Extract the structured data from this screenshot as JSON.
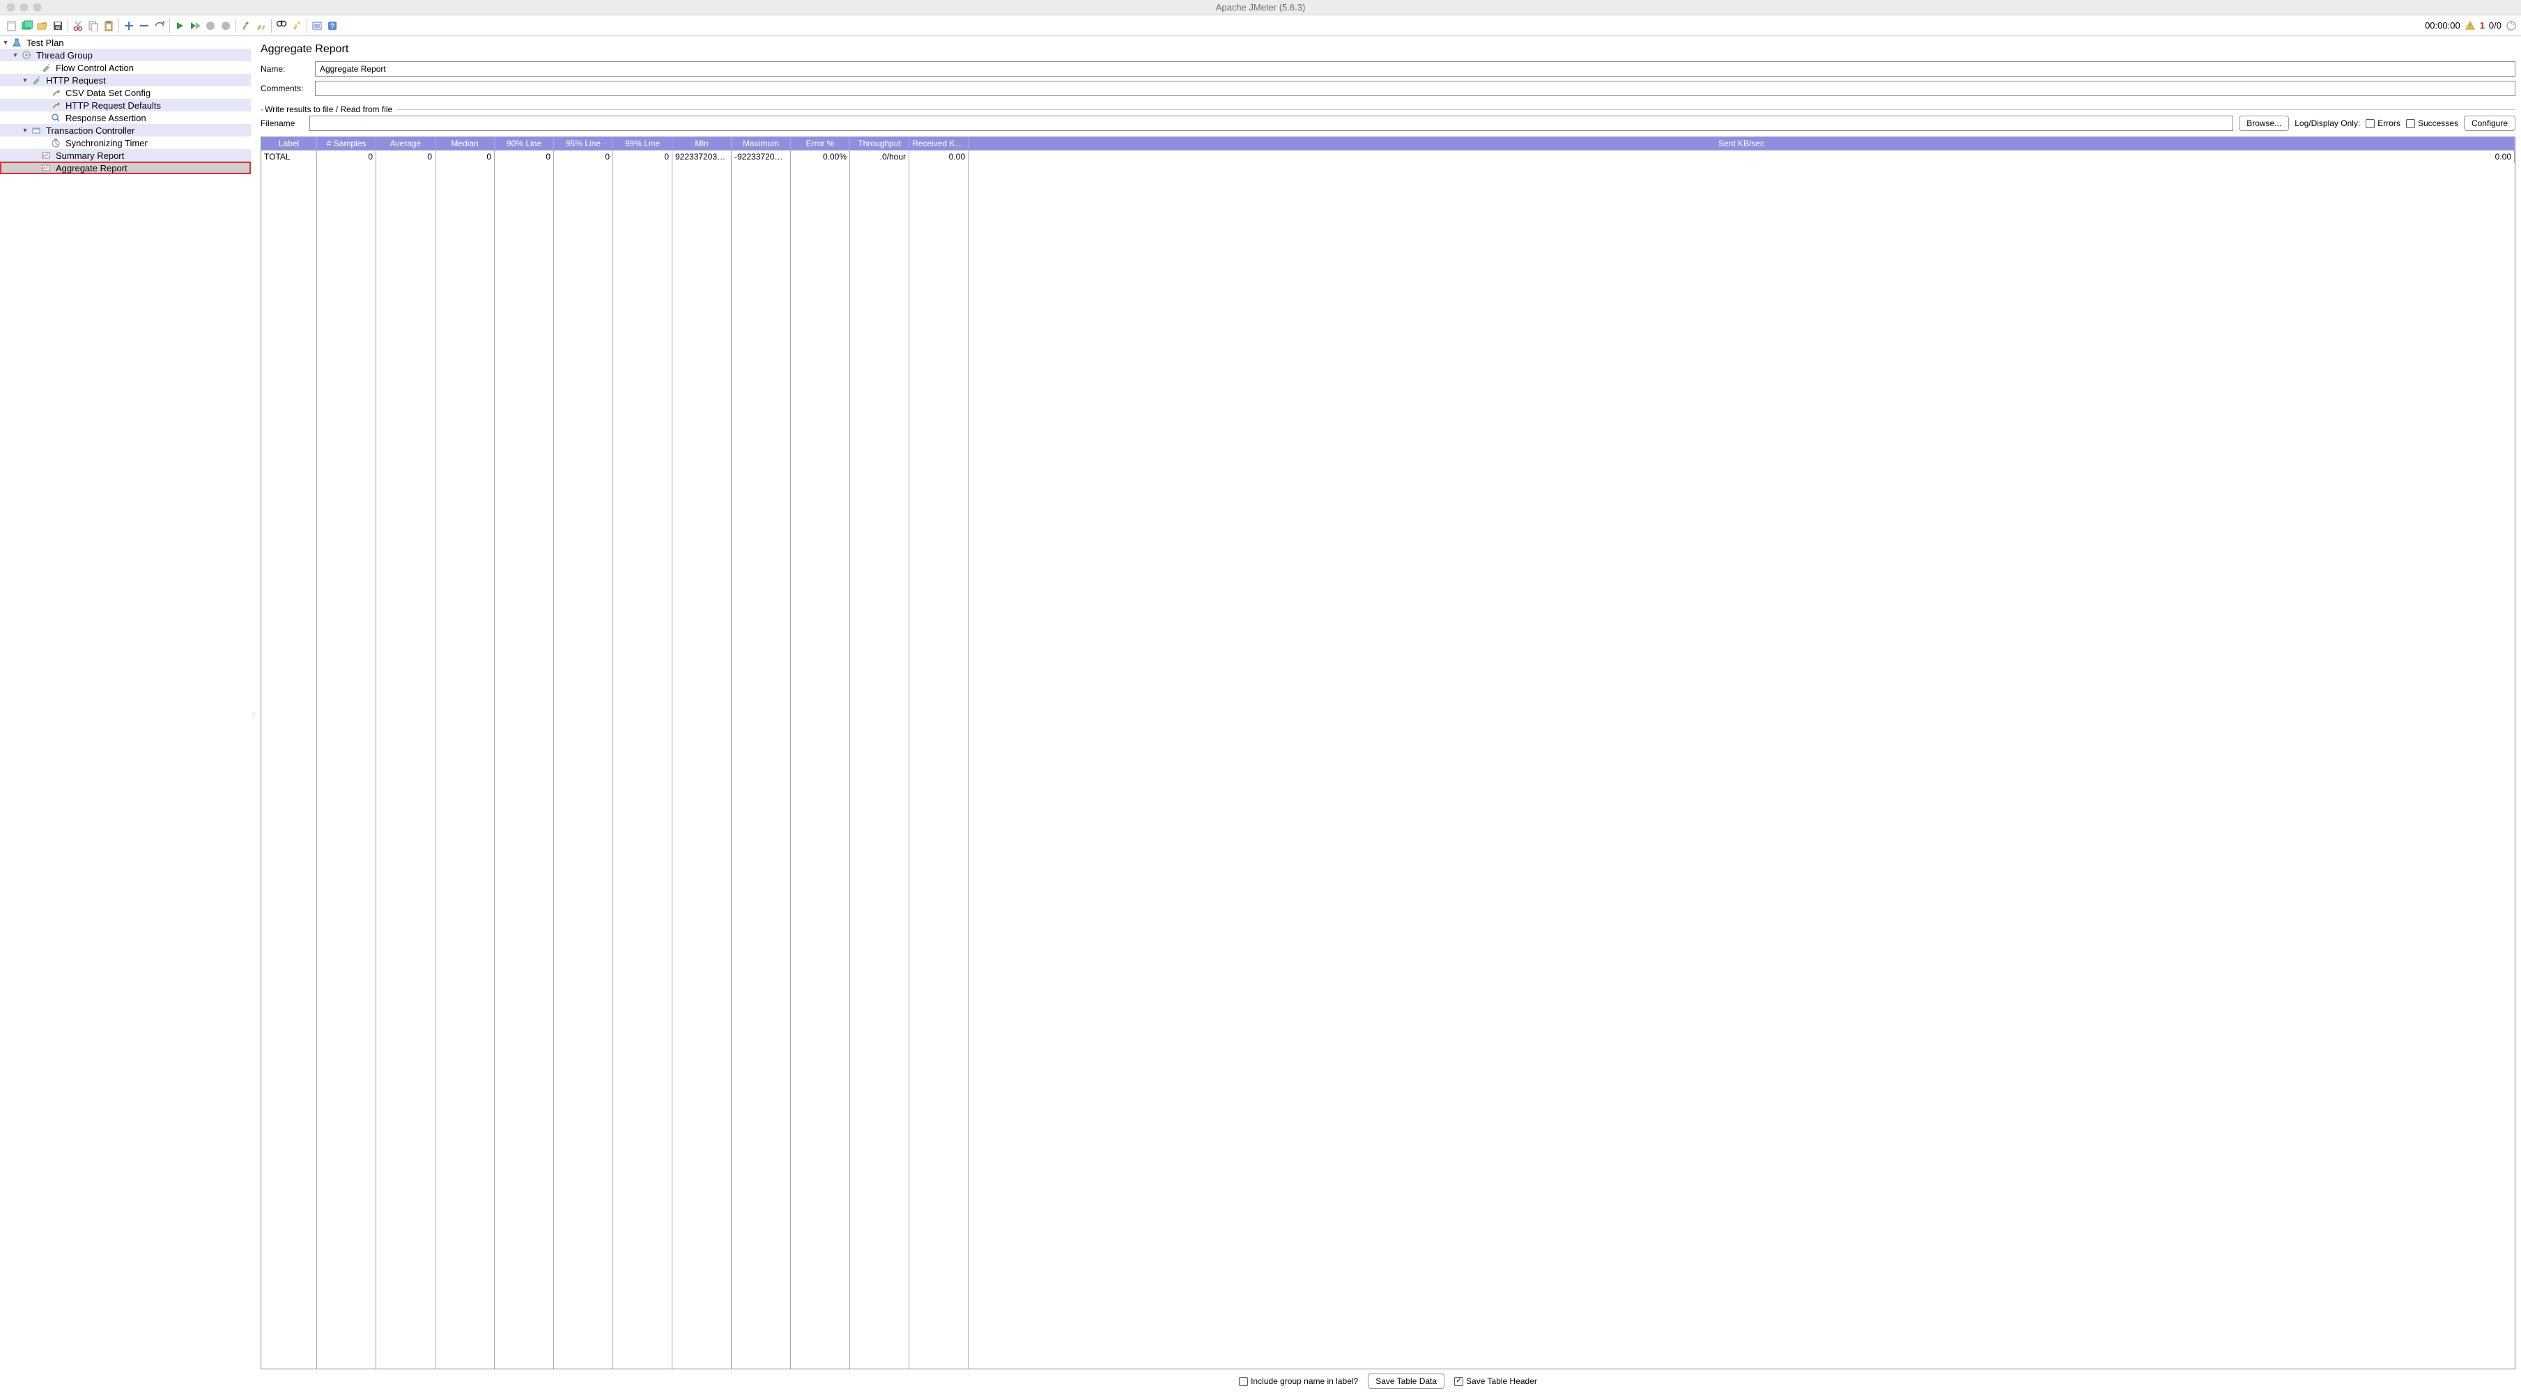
{
  "window": {
    "title": "Apache JMeter (5.6.3)"
  },
  "toolbar": {
    "time": "00:00:00",
    "warn_count": "1",
    "run_status": "0/0"
  },
  "tree": {
    "root": "Test Plan",
    "items": [
      "Thread Group",
      "Flow Control Action",
      "HTTP Request",
      "CSV Data Set Config",
      "HTTP Request Defaults",
      "Response Assertion",
      "Transaction Controller",
      "Synchronizing Timer",
      "Summary Report",
      "Aggregate Report"
    ]
  },
  "editor": {
    "title": "Aggregate Report",
    "labels": {
      "name": "Name:",
      "comments": "Comments:",
      "writeResults": "Write results to file / Read from file",
      "filename": "Filename",
      "browse": "Browse...",
      "logDisplay": "Log/Display Only:",
      "errors": "Errors",
      "successes": "Successes",
      "configure": "Configure"
    },
    "name_value": "Aggregate Report",
    "comments_value": "",
    "filename_value": ""
  },
  "table": {
    "headers": [
      "Label",
      "# Samples",
      "Average",
      "Median",
      "90% Line",
      "95% Line",
      "99% Line",
      "Min",
      "Maximum",
      "Error %",
      "Throughput",
      "Received KB/...",
      "Sent KB/sec"
    ],
    "rows": [
      {
        "cells": [
          "TOTAL",
          "0",
          "0",
          "0",
          "0",
          "0",
          "0",
          "92233720368...",
          "-9223372036...",
          "0.00%",
          ".0/hour",
          "0.00",
          "0.00"
        ]
      }
    ]
  },
  "bottom": {
    "includeGroup": "Include group name in label?",
    "saveTableData": "Save Table Data",
    "saveTableHeader": "Save Table Header"
  }
}
